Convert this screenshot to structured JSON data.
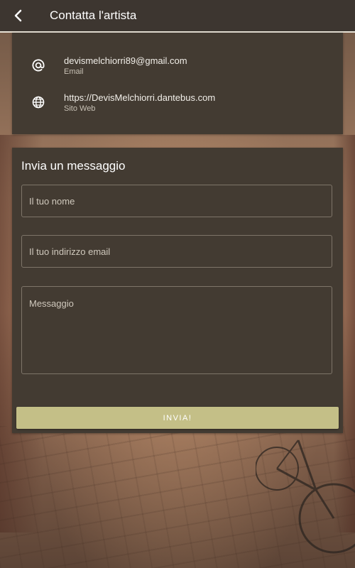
{
  "appbar": {
    "title": "Contatta l'artista",
    "back_icon": "chevron-left-icon"
  },
  "contact_info": {
    "email": {
      "icon": "at-sign-icon",
      "value": "devismelchiorri89@gmail.com",
      "label": "Email"
    },
    "website": {
      "icon": "globe-icon",
      "value": "https://DevisMelchiorri.dantebus.com",
      "label": "Sito Web"
    }
  },
  "form": {
    "title": "Invia un messaggio",
    "name_placeholder": "Il tuo nome",
    "email_placeholder": "Il tuo indirizzo email",
    "message_placeholder": "Messaggio",
    "send_label": "INVIA!"
  },
  "colors": {
    "appbar": "#3d3630",
    "card": "#433b32",
    "button": "#c4bf87"
  }
}
